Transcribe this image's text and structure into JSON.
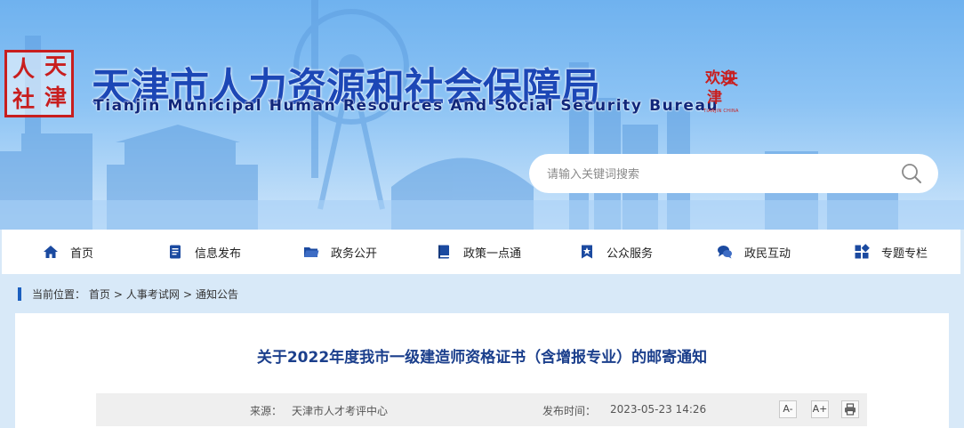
{
  "site": {
    "title_zh": "天津市人力资源和社会保障局",
    "title_en": "Tianjin Municipal Human Resources And Social Security Bureau",
    "logo_chars": [
      "人",
      "天",
      "社",
      "津"
    ],
    "city_seal": {
      "chars": [
        "天",
        "津",
        "欢迎"
      ],
      "caption": "TIANJIN CHINA"
    }
  },
  "search": {
    "placeholder": "请输入关键词搜索"
  },
  "nav": {
    "items": [
      {
        "label": "首页",
        "icon": "home-icon"
      },
      {
        "label": "信息发布",
        "icon": "document-icon"
      },
      {
        "label": "政务公开",
        "icon": "folder-icon"
      },
      {
        "label": "政策一点通",
        "icon": "book-icon"
      },
      {
        "label": "公众服务",
        "icon": "bookmark-star-icon"
      },
      {
        "label": "政民互动",
        "icon": "chat-icon"
      },
      {
        "label": "专题专栏",
        "icon": "grid-icon"
      }
    ]
  },
  "breadcrumb": {
    "prefix": "当前位置：",
    "items": [
      "首页",
      "人事考试网",
      "通知公告"
    ],
    "separator": ">"
  },
  "article": {
    "title": "关于2022年度我市一级建造师资格证书（含增报专业）的邮寄通知",
    "source_label": "来源：",
    "source": "天津市人才考评中心",
    "time_label": "发布时间：",
    "time": "2023-05-23 14:26",
    "tools": {
      "font_smaller": "A-",
      "font_larger": "A+"
    }
  },
  "colors": {
    "brand_blue": "#1c47b6",
    "seal_red": "#c81e1e",
    "banner_sky": "#8cc3f4",
    "nav_icon": "#1b4aa0"
  }
}
